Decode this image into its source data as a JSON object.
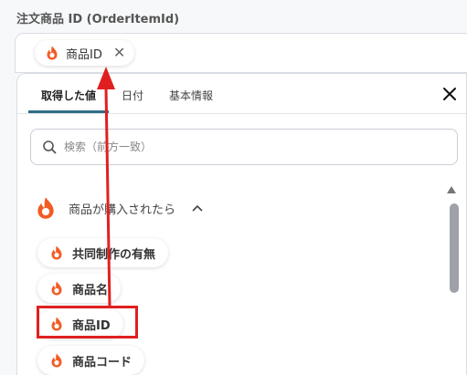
{
  "field": {
    "label": "注文商品 ID (OrderItemId)",
    "chip_label": "商品ID",
    "chip_close": "✕"
  },
  "panel": {
    "tabs": [
      {
        "label": "取得した値"
      },
      {
        "label": "日付"
      },
      {
        "label": "基本情報"
      }
    ],
    "search_placeholder": "検索（前方一致）",
    "group_label": "商品が購入されたら",
    "items": [
      {
        "label": "共同制作の有無"
      },
      {
        "label": "商品名"
      },
      {
        "label": "商品ID"
      },
      {
        "label": "商品コード"
      }
    ]
  },
  "colors": {
    "icon": "#f25c24",
    "highlight": "#e02020",
    "tab_active": "#2f6d86"
  }
}
